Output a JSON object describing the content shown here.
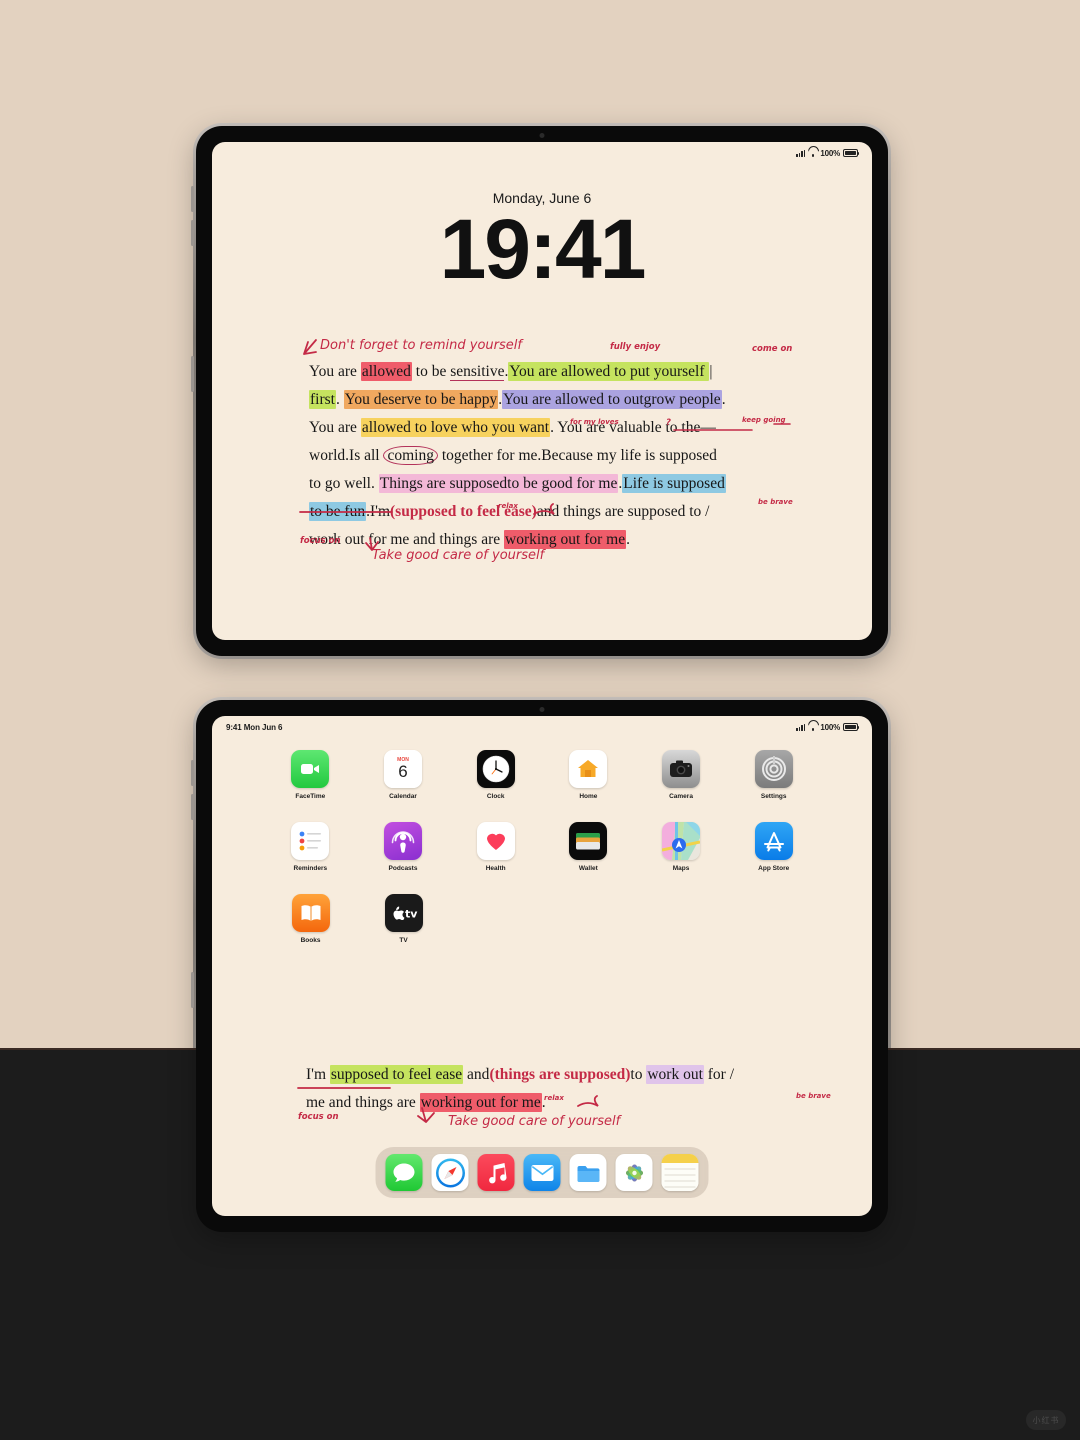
{
  "background": {
    "top_color": "#e3d2c0",
    "bottom_color": "#1c1c1c"
  },
  "tablet_lock": {
    "name": "lock-screen-tablet",
    "status_bar": {
      "battery_pct": "100%",
      "signal": "signal-icon",
      "wifi": "wifi-icon",
      "battery": "battery-icon"
    },
    "date": "Monday, June 6",
    "time": "19:41",
    "note": {
      "lines": [
        [
          {
            "t": "You are ",
            "hl": ""
          },
          {
            "t": "allowed",
            "hl": "hl-red"
          },
          {
            "t": " to be ",
            "hl": ""
          },
          {
            "t": "sensitive",
            "hl": "squiggle"
          },
          {
            "t": ".",
            "hl": ""
          },
          {
            "t": "You are allowed to put yourself ",
            "hl": "hl-green"
          },
          {
            "t": "|",
            "hl": ""
          }
        ],
        [
          {
            "t": "first",
            "hl": "hl-green"
          },
          {
            "t": ". ",
            "hl": ""
          },
          {
            "t": "You deserve to be happy",
            "hl": "hl-orange"
          },
          {
            "t": ".",
            "hl": ""
          },
          {
            "t": "You are allowed to outgrow people",
            "hl": "hl-purple"
          },
          {
            "t": ".",
            "hl": ""
          }
        ],
        [
          {
            "t": "You are ",
            "hl": ""
          },
          {
            "t": "allowed to love who you want",
            "hl": "hl-yellow"
          },
          {
            "t": ". You are valuable to the",
            "hl": ""
          },
          {
            "t": "—",
            "hl": ""
          }
        ],
        [
          {
            "t": "world.Is all ",
            "hl": ""
          },
          {
            "t": "coming",
            "hl": "circle-ann"
          },
          {
            "t": " together for me.Because my life is supposed",
            "hl": ""
          }
        ],
        [
          {
            "t": "to go well. ",
            "hl": ""
          },
          {
            "t": "Things are supposedto be good for me",
            "hl": "hl-pink"
          },
          {
            "t": ".",
            "hl": ""
          },
          {
            "t": "Life is supposed",
            "hl": "hl-blue"
          }
        ],
        [
          {
            "t": "to be fun",
            "hl": "hl-blue"
          },
          {
            "t": ".I'm",
            "hl": ""
          },
          {
            "t": "(supposed to feel ease)",
            "hl": "paren-ann"
          },
          {
            "t": "and things are supposed to",
            "hl": ""
          },
          {
            "t": " /",
            "hl": ""
          }
        ],
        [
          {
            "t": "work out for me and things are ",
            "hl": ""
          },
          {
            "t": "working out for me",
            "hl": "hl-red"
          },
          {
            "t": ".",
            "hl": ""
          }
        ]
      ]
    },
    "annotations": [
      {
        "text": "Don't forget to remind yourself",
        "size": "lg"
      },
      {
        "text": "fully enjoy",
        "size": "sm"
      },
      {
        "text": "come on",
        "size": "sm"
      },
      {
        "text": "for my loves",
        "size": "xs"
      },
      {
        "text": "?",
        "size": "sm"
      },
      {
        "text": "keep going",
        "size": "xs"
      },
      {
        "text": "relax",
        "size": "xs"
      },
      {
        "text": "be brave",
        "size": "xs"
      },
      {
        "text": "focus on",
        "size": "sm"
      },
      {
        "text": "Take good care of yourself",
        "size": "lg"
      }
    ]
  },
  "tablet_home": {
    "name": "home-screen-tablet",
    "status_bar": {
      "left": "9:41 Mon Jun 6",
      "battery_pct": "100%"
    },
    "app_rows": [
      [
        {
          "label": "FaceTime",
          "icon": "facetime-icon"
        },
        {
          "label": "Calendar",
          "icon": "calendar-icon",
          "day_name": "MON",
          "day_num": "6"
        },
        {
          "label": "Clock",
          "icon": "clock-icon"
        },
        {
          "label": "Home",
          "icon": "home-icon"
        },
        {
          "label": "Camera",
          "icon": "camera-icon"
        },
        {
          "label": "Settings",
          "icon": "settings-icon"
        }
      ],
      [
        {
          "label": "Reminders",
          "icon": "reminders-icon"
        },
        {
          "label": "Podcasts",
          "icon": "podcasts-icon"
        },
        {
          "label": "Health",
          "icon": "health-icon"
        },
        {
          "label": "Wallet",
          "icon": "wallet-icon"
        },
        {
          "label": "Maps",
          "icon": "maps-icon"
        },
        {
          "label": "App Store",
          "icon": "appstore-icon"
        }
      ],
      [
        {
          "label": "Books",
          "icon": "books-icon"
        },
        {
          "label": "TV",
          "icon": "tv-icon"
        }
      ]
    ],
    "dock": [
      {
        "label": "Messages",
        "icon": "messages-icon"
      },
      {
        "label": "Safari",
        "icon": "safari-icon"
      },
      {
        "label": "Music",
        "icon": "music-icon"
      },
      {
        "label": "Mail",
        "icon": "mail-icon"
      },
      {
        "label": "Files",
        "icon": "files-icon"
      },
      {
        "label": "Photos",
        "icon": "photos-icon"
      },
      {
        "label": "Notes",
        "icon": "notes-icon"
      }
    ],
    "note": {
      "lines": [
        [
          {
            "t": "I'm ",
            "hl": ""
          },
          {
            "t": "supposed to feel ease",
            "hl": "hl-green"
          },
          {
            "t": " and",
            "hl": ""
          },
          {
            "t": "(things are supposed)",
            "hl": "paren-ann"
          },
          {
            "t": "to ",
            "hl": ""
          },
          {
            "t": "work out",
            "hl": "hl-lilac"
          },
          {
            "t": " for",
            "hl": ""
          },
          {
            "t": " /",
            "hl": ""
          }
        ],
        [
          {
            "t": "me and things are ",
            "hl": ""
          },
          {
            "t": "working out for me",
            "hl": "hl-red"
          },
          {
            "t": ".",
            "hl": ""
          }
        ]
      ]
    },
    "annotations": [
      {
        "text": "relax",
        "size": "xs"
      },
      {
        "text": "be brave",
        "size": "xs"
      },
      {
        "text": "focus on",
        "size": "sm"
      },
      {
        "text": "Take good care of yourself",
        "size": "lg"
      }
    ]
  },
  "watermark": {
    "text": "小红书"
  }
}
